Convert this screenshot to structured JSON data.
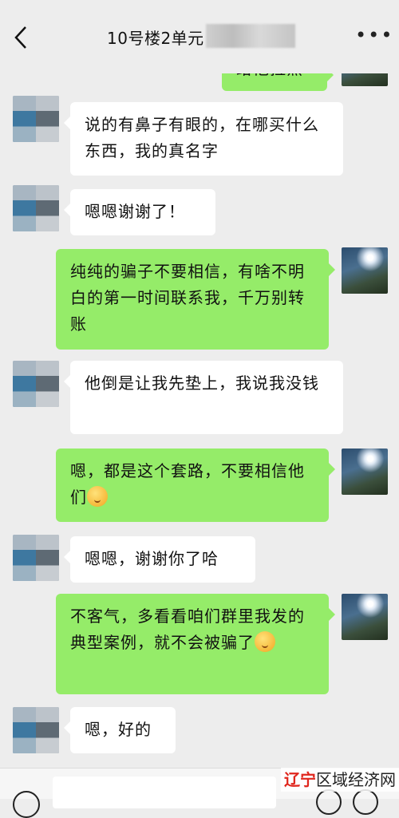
{
  "header": {
    "title": "10号楼2单元",
    "back_icon": "chevron-left-icon",
    "more_icon": "ellipsis-icon"
  },
  "messages": [
    {
      "from": "self",
      "text": "给他拉黑"
    },
    {
      "from": "other",
      "text": "说的有鼻子有眼的，在哪买什么东西，我的真名字"
    },
    {
      "from": "other",
      "text": "嗯嗯谢谢了！"
    },
    {
      "from": "self",
      "text": "纯纯的骗子不要相信，有啥不明白的第一时间联系我，千万别转账"
    },
    {
      "from": "other",
      "text": "他倒是让我先垫上，我说我没钱"
    },
    {
      "from": "self",
      "text": "嗯，都是这个套路，不要相信他们",
      "emoji": "shushing-face-emoji"
    },
    {
      "from": "other",
      "text": "嗯嗯，谢谢你了哈"
    },
    {
      "from": "self",
      "text": "不客气，多看看咱们群里我发的典型案例，就不会被骗了",
      "emoji": "shushing-face-emoji"
    },
    {
      "from": "other",
      "text": "嗯，好的"
    }
  ],
  "watermark": {
    "brand": "辽宁",
    "rest": "区域经济网"
  },
  "colors": {
    "background": "#ededed",
    "self_bubble": "#95ec69",
    "other_bubble": "#ffffff",
    "watermark_red": "#e0261d"
  }
}
